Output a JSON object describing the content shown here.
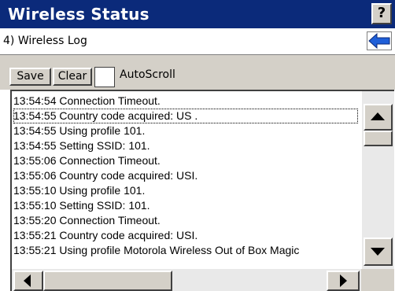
{
  "window": {
    "title": "Wireless Status",
    "help_label": "?"
  },
  "subheader": {
    "label": "4) Wireless Log"
  },
  "toolbar": {
    "save_label": "Save",
    "clear_label": "Clear",
    "autoscroll_label": "AutoScroll",
    "autoscroll_checked": false
  },
  "log": {
    "rows": [
      {
        "time": "13:54:54",
        "message": "Connection Timeout."
      },
      {
        "time": "13:54:55",
        "message": "Country code acquired: US ."
      },
      {
        "time": "13:54:55",
        "message": "Using profile 101."
      },
      {
        "time": "13:54:55",
        "message": "Setting SSID: 101."
      },
      {
        "time": "13:55:06",
        "message": "Connection Timeout."
      },
      {
        "time": "13:55:06",
        "message": "Country code acquired: USI."
      },
      {
        "time": "13:55:10",
        "message": "Using profile 101."
      },
      {
        "time": "13:55:10",
        "message": "Setting SSID: 101."
      },
      {
        "time": "13:55:20",
        "message": "Connection Timeout."
      },
      {
        "time": "13:55:21",
        "message": "Country code acquired: USI."
      },
      {
        "time": "13:55:21",
        "message": "Using profile Motorola Wireless Out of Box Magic"
      }
    ],
    "selected_index": 1
  },
  "icons": {
    "help": "question-mark-icon",
    "back": "back-arrow-icon",
    "scroll_up": "arrow-up-icon",
    "scroll_down": "arrow-down-icon",
    "scroll_left": "arrow-left-icon",
    "scroll_right": "arrow-right-icon"
  },
  "colors": {
    "title_bar": "#0b2a7a",
    "accent_arrow": "#1f5fd8",
    "chrome": "#d4d0c8"
  }
}
